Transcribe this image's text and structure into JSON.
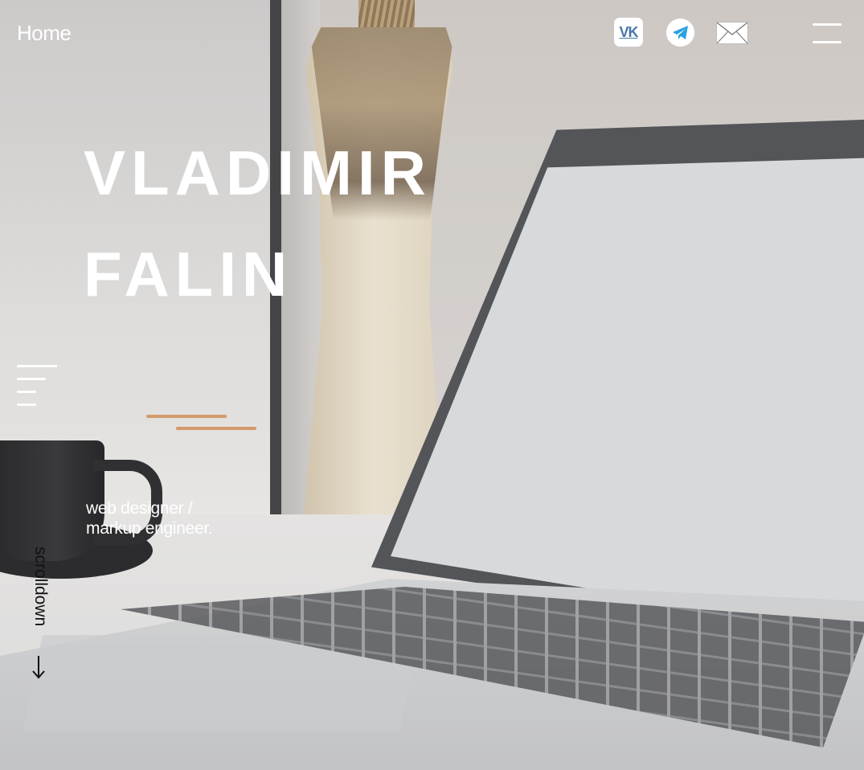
{
  "nav": {
    "home_label": "Home",
    "social": [
      {
        "name": "vk",
        "label": "VK",
        "icon": "vk-icon",
        "color": "#4a76a8"
      },
      {
        "name": "telegram",
        "icon": "telegram-icon",
        "color": "#2aa3df"
      },
      {
        "name": "email",
        "icon": "mail-icon"
      }
    ],
    "menu_icon": "hamburger-menu-icon"
  },
  "hero": {
    "first_name": "VLADIMIR",
    "last_name": "FALIN",
    "role_line1": "web designer /",
    "role_line2": "markup engineer.",
    "accent_color": "#d39a6a"
  },
  "scroll": {
    "label": "scrolldown",
    "arrow": "→"
  }
}
